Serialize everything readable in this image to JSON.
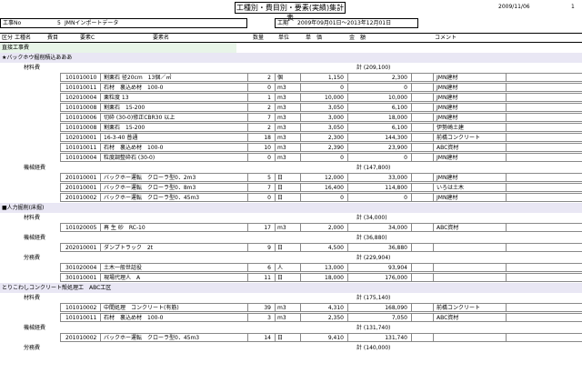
{
  "title": "工種別・費目別・要素(実績)集計表",
  "print_date": "2009/11/06",
  "page_no": "1",
  "project": {
    "label": "工事No",
    "no": "5",
    "name": "JMNインポートデータ"
  },
  "period": {
    "label": "工期",
    "value": "2009年09月01日～2013年12月01日"
  },
  "columns": {
    "kubun": "区分",
    "koshu": "工種名",
    "himoku": "費目",
    "yoso_c": "要素C",
    "yoso_name": "要素名",
    "qty": "数量",
    "unit": "単位",
    "price": "単　価",
    "amount": "金　額",
    "comment": "コメント"
  },
  "rows": [
    {
      "kind": "section",
      "label": "直接工事費"
    },
    {
      "kind": "koshu",
      "label": "★バックホウ掘削積込あああ"
    },
    {
      "kind": "himoku",
      "label": "材料費",
      "total": "計 (209,100)"
    },
    {
      "kind": "item",
      "code": "101010010",
      "name": "割栗石 径20cm　13個／㎡",
      "qty": "2",
      "unit": "個",
      "price": "1,150",
      "amount": "2,300",
      "comment": "JMN建材"
    },
    {
      "kind": "item",
      "code": "101010011",
      "name": "石材　裏込め材　100-0",
      "qty": "0",
      "unit": "m3",
      "price": "0",
      "amount": "0",
      "comment": "JMN建材"
    },
    {
      "kind": "item",
      "code": "102010004",
      "name": "栗粒度 13",
      "qty": "1",
      "unit": "m3",
      "price": "10,000",
      "amount": "10,000",
      "comment": "JMN建材"
    },
    {
      "kind": "item",
      "code": "101010008",
      "name": "割栗石　15-200",
      "qty": "2",
      "unit": "m3",
      "price": "3,050",
      "amount": "6,100",
      "comment": "JMN建材"
    },
    {
      "kind": "item",
      "code": "101010006",
      "name": "切砕 (30-0)修正CBR30 以上",
      "qty": "7",
      "unit": "m3",
      "price": "3,000",
      "amount": "18,000",
      "comment": "JMN建材"
    },
    {
      "kind": "item",
      "code": "101010008",
      "name": "割栗石　15-200",
      "qty": "2",
      "unit": "m3",
      "price": "3,050",
      "amount": "6,100",
      "comment": "伊勢崎土建"
    },
    {
      "kind": "item",
      "code": "102010001",
      "name": "16-3-40 普通",
      "qty": "18",
      "unit": "m3",
      "price": "2,300",
      "amount": "144,300",
      "comment": "前橋コンクリート"
    },
    {
      "kind": "item",
      "code": "101010011",
      "name": "石材　裏込め材　100-0",
      "qty": "10",
      "unit": "m3",
      "price": "2,390",
      "amount": "23,900",
      "comment": "ABC資材"
    },
    {
      "kind": "item",
      "code": "101010004",
      "name": "粒度調整砕石 (30-0)",
      "qty": "0",
      "unit": "m3",
      "price": "0",
      "amount": "0",
      "comment": "JMN建材"
    },
    {
      "kind": "himoku",
      "label": "機械経費",
      "total": "計 (147,800)"
    },
    {
      "kind": "item",
      "code": "201010001",
      "name": "バックホー運転　クローラ型0．2m3",
      "qty": "5",
      "unit": "日",
      "price": "12,000",
      "amount": "33,000",
      "comment": "JMN建材"
    },
    {
      "kind": "item",
      "code": "201010001",
      "name": "バックホー運転　クローラ型0．8m3",
      "qty": "7",
      "unit": "日",
      "price": "16,400",
      "amount": "114,800",
      "comment": "いろは土木"
    },
    {
      "kind": "item",
      "code": "201010002",
      "name": "バックホー運転　クローラ型0．45m3",
      "qty": "0",
      "unit": "日",
      "price": "0",
      "amount": "0",
      "comment": "JMN建材"
    },
    {
      "kind": "koshu",
      "label": "■人力掘削(床掘)"
    },
    {
      "kind": "himoku",
      "label": "材料費",
      "total": "計 (34,000)"
    },
    {
      "kind": "item",
      "code": "101020005",
      "name": "再 生 砂　RC-10",
      "qty": "17",
      "unit": "m3",
      "price": "2,000",
      "amount": "34,000",
      "comment": "ABC資材"
    },
    {
      "kind": "himoku",
      "label": "機械経費",
      "total": "計 (36,880)"
    },
    {
      "kind": "item",
      "code": "202010001",
      "name": "ダンプトラック　2t",
      "qty": "9",
      "unit": "日",
      "price": "4,500",
      "amount": "36,880",
      "comment": ""
    },
    {
      "kind": "himoku",
      "label": "労務費",
      "total": "計 (229,904)"
    },
    {
      "kind": "item",
      "code": "301020004",
      "name": "土木一般世話役",
      "qty": "6",
      "unit": "人",
      "price": "13,000",
      "amount": "93,904",
      "comment": ""
    },
    {
      "kind": "item",
      "code": "301010001",
      "name": "現場代理人　A",
      "qty": "11",
      "unit": "日",
      "price": "18,000",
      "amount": "176,000",
      "comment": ""
    },
    {
      "kind": "koshu",
      "label": "とりこわしコンクリート殻処理工　ABC工区"
    },
    {
      "kind": "himoku",
      "label": "材料費",
      "total": "計 (175,140)"
    },
    {
      "kind": "item",
      "code": "101010002",
      "name": "中間処理　コンクリート(有筋)",
      "qty": "39",
      "unit": "m3",
      "price": "4,310",
      "amount": "168,090",
      "comment": "前橋コンクリート"
    },
    {
      "kind": "item",
      "code": "101010011",
      "name": "石材　裏込め材　100-0",
      "qty": "3",
      "unit": "m3",
      "price": "2,350",
      "amount": "7,050",
      "comment": "ABC資材"
    },
    {
      "kind": "himoku",
      "label": "機械経費",
      "total": "計 (131,740)"
    },
    {
      "kind": "item",
      "code": "201010002",
      "name": "バックホー運転　クローラ型0．45m3",
      "qty": "14",
      "unit": "日",
      "price": "9,410",
      "amount": "131,740",
      "comment": ""
    },
    {
      "kind": "himoku",
      "label": "労務費",
      "total": "計 (140,000)"
    }
  ]
}
